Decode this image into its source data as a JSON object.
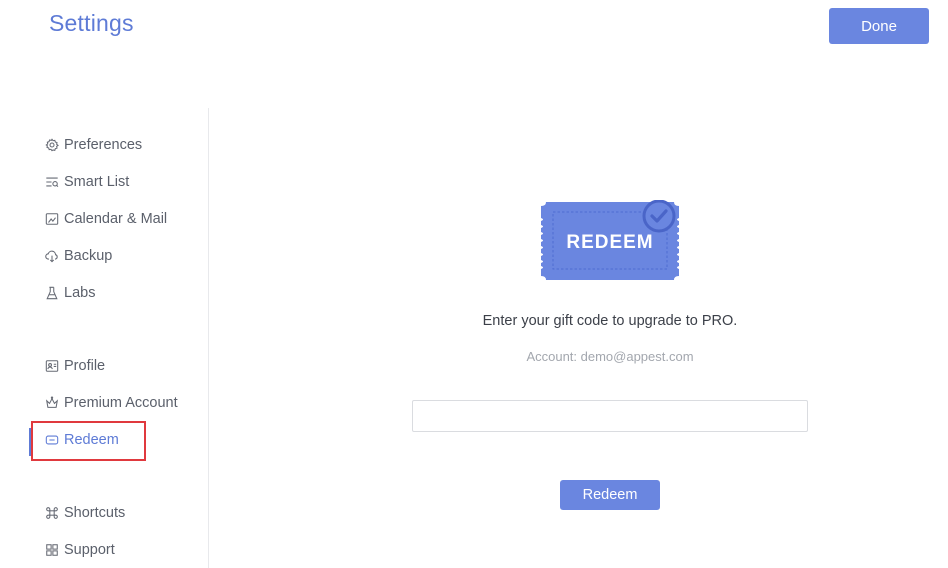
{
  "header": {
    "title": "Settings",
    "done_label": "Done"
  },
  "sidebar": {
    "items": [
      {
        "label": "Preferences",
        "icon": "gear-icon"
      },
      {
        "label": "Smart List",
        "icon": "smart-list-icon"
      },
      {
        "label": "Calendar & Mail",
        "icon": "calendar-mail-icon"
      },
      {
        "label": "Backup",
        "icon": "cloud-icon"
      },
      {
        "label": "Labs",
        "icon": "flask-icon"
      },
      {
        "label": "Profile",
        "icon": "profile-card-icon"
      },
      {
        "label": "Premium Account",
        "icon": "crown-icon"
      },
      {
        "label": "Redeem",
        "icon": "ticket-icon"
      },
      {
        "label": "Shortcuts",
        "icon": "command-key-icon"
      },
      {
        "label": "Support",
        "icon": "grid-icon"
      }
    ],
    "active": "Redeem"
  },
  "main": {
    "ticket_text": "REDEEM",
    "gift_prompt": "Enter your gift code to upgrade to PRO.",
    "account_text": "Account: demo@appest.com",
    "code_input": {
      "value": "",
      "placeholder": ""
    },
    "redeem_label": "Redeem"
  },
  "colors": {
    "accent": "#6a86e0",
    "title": "#5e7bd6",
    "highlight": "#e0393e"
  }
}
